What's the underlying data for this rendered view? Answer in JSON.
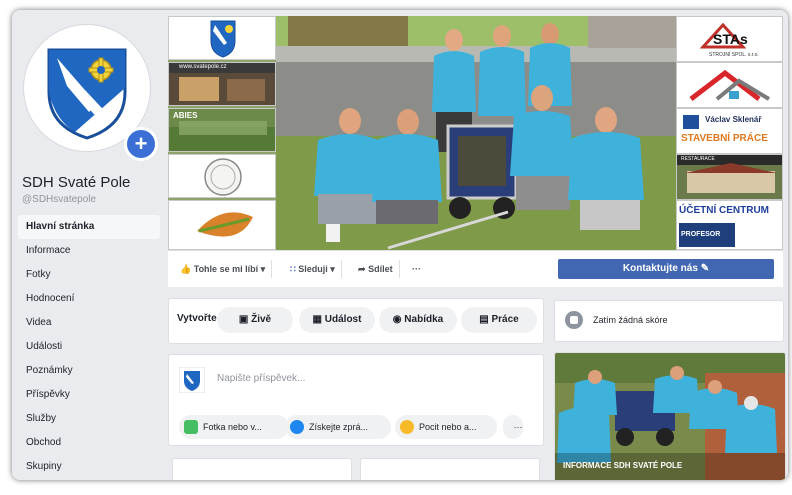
{
  "page": {
    "name": "SDH Svaté Pole",
    "handle": "@SDHsvatepole"
  },
  "nav": [
    {
      "label": "Hlavní stránka"
    },
    {
      "label": "Informace"
    },
    {
      "label": "Fotky"
    },
    {
      "label": "Hodnocení"
    },
    {
      "label": "Videa"
    },
    {
      "label": "Události"
    },
    {
      "label": "Poznámky"
    },
    {
      "label": "Příspěvky"
    },
    {
      "label": "Služby"
    },
    {
      "label": "Obchod"
    },
    {
      "label": "Skupiny"
    }
  ],
  "cover_tiles": {
    "left": [
      "www.svatepole.cz",
      "ABIES"
    ],
    "right": [
      "STAs",
      "STROJNÍ SPOL. s.r.o.",
      "Václav Sklenář",
      "STAVEBNÍ PRÁCE",
      "RESTAURACE",
      "ÚČETNÍ CENTRUM",
      "PROFESOR"
    ]
  },
  "actions": {
    "like": "Tohle se mi líbí",
    "follow": "Sleduji",
    "share": "Sdílet",
    "more": "···",
    "contact": "Kontaktujte nás"
  },
  "create": {
    "label": "Vytvořte",
    "buttons": [
      "Živě",
      "Událost",
      "Nabídka",
      "Práce"
    ]
  },
  "composer": {
    "placeholder": "Napište příspěvek...",
    "options": [
      "Fotka nebo v...",
      "Získejte zprá...",
      "Pocit nebo a...",
      "···"
    ]
  },
  "rating": {
    "text": "Zatím žádná skóre"
  },
  "photo_card": {
    "caption": "INFORMACE SDH SVATÉ POLE"
  },
  "colors": {
    "facebook_blue": "#4267b2",
    "shirt_blue": "#3fb2dc",
    "background": "#e9ebee"
  },
  "icons": {
    "like": "thumbs-up-icon",
    "follow": "rss-icon",
    "share": "share-arrow-icon",
    "contact": "pencil-icon",
    "live": "video-camera-icon",
    "event": "calendar-icon",
    "offer": "tag-icon",
    "job": "briefcase-icon",
    "photo": "photo-icon",
    "messenger": "messenger-icon",
    "feeling": "smiley-icon",
    "rating": "speech-bubble-icon",
    "add": "plus-icon"
  }
}
